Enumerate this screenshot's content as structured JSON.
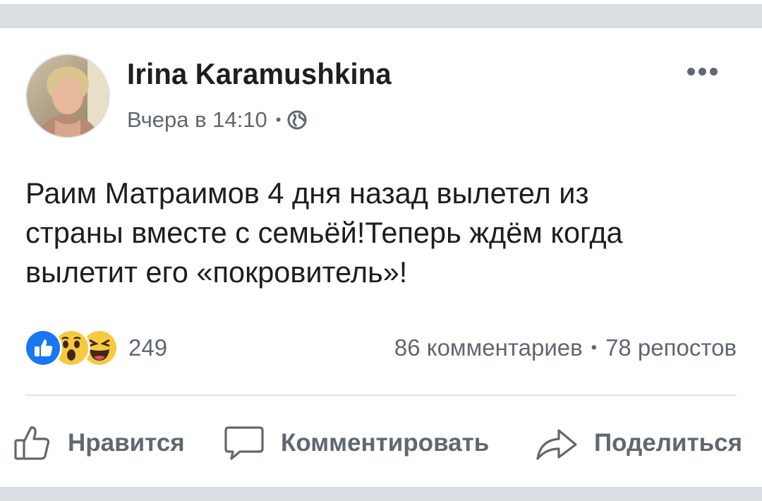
{
  "post": {
    "author": "Irina Karamushkina",
    "timestamp": "Вчера в 14:10",
    "meta_separator": "•",
    "audience_icon": "globe-icon",
    "more_icon": "more-options-icon",
    "text": "Раим Матраимов  4 дня назад вылетел из\nстраны вместе с семьёй!Теперь ждём когда\nвылетит его «покровитель»!"
  },
  "reactions": {
    "icons": [
      "like-reaction-icon",
      "wow-reaction-icon",
      "haha-reaction-icon"
    ],
    "count": "249"
  },
  "stats": {
    "comments": "86 комментариев",
    "separator": "•",
    "shares": "78 репостов"
  },
  "actions": {
    "like": "Нравится",
    "comment": "Комментировать",
    "share": "Поделиться"
  },
  "colors": {
    "like_blue": "#1877f2",
    "emoji_yellow": "#f7c93e",
    "secondary_text": "#606770",
    "primary_text": "#1c1e21",
    "background_gray": "#dadde1"
  }
}
